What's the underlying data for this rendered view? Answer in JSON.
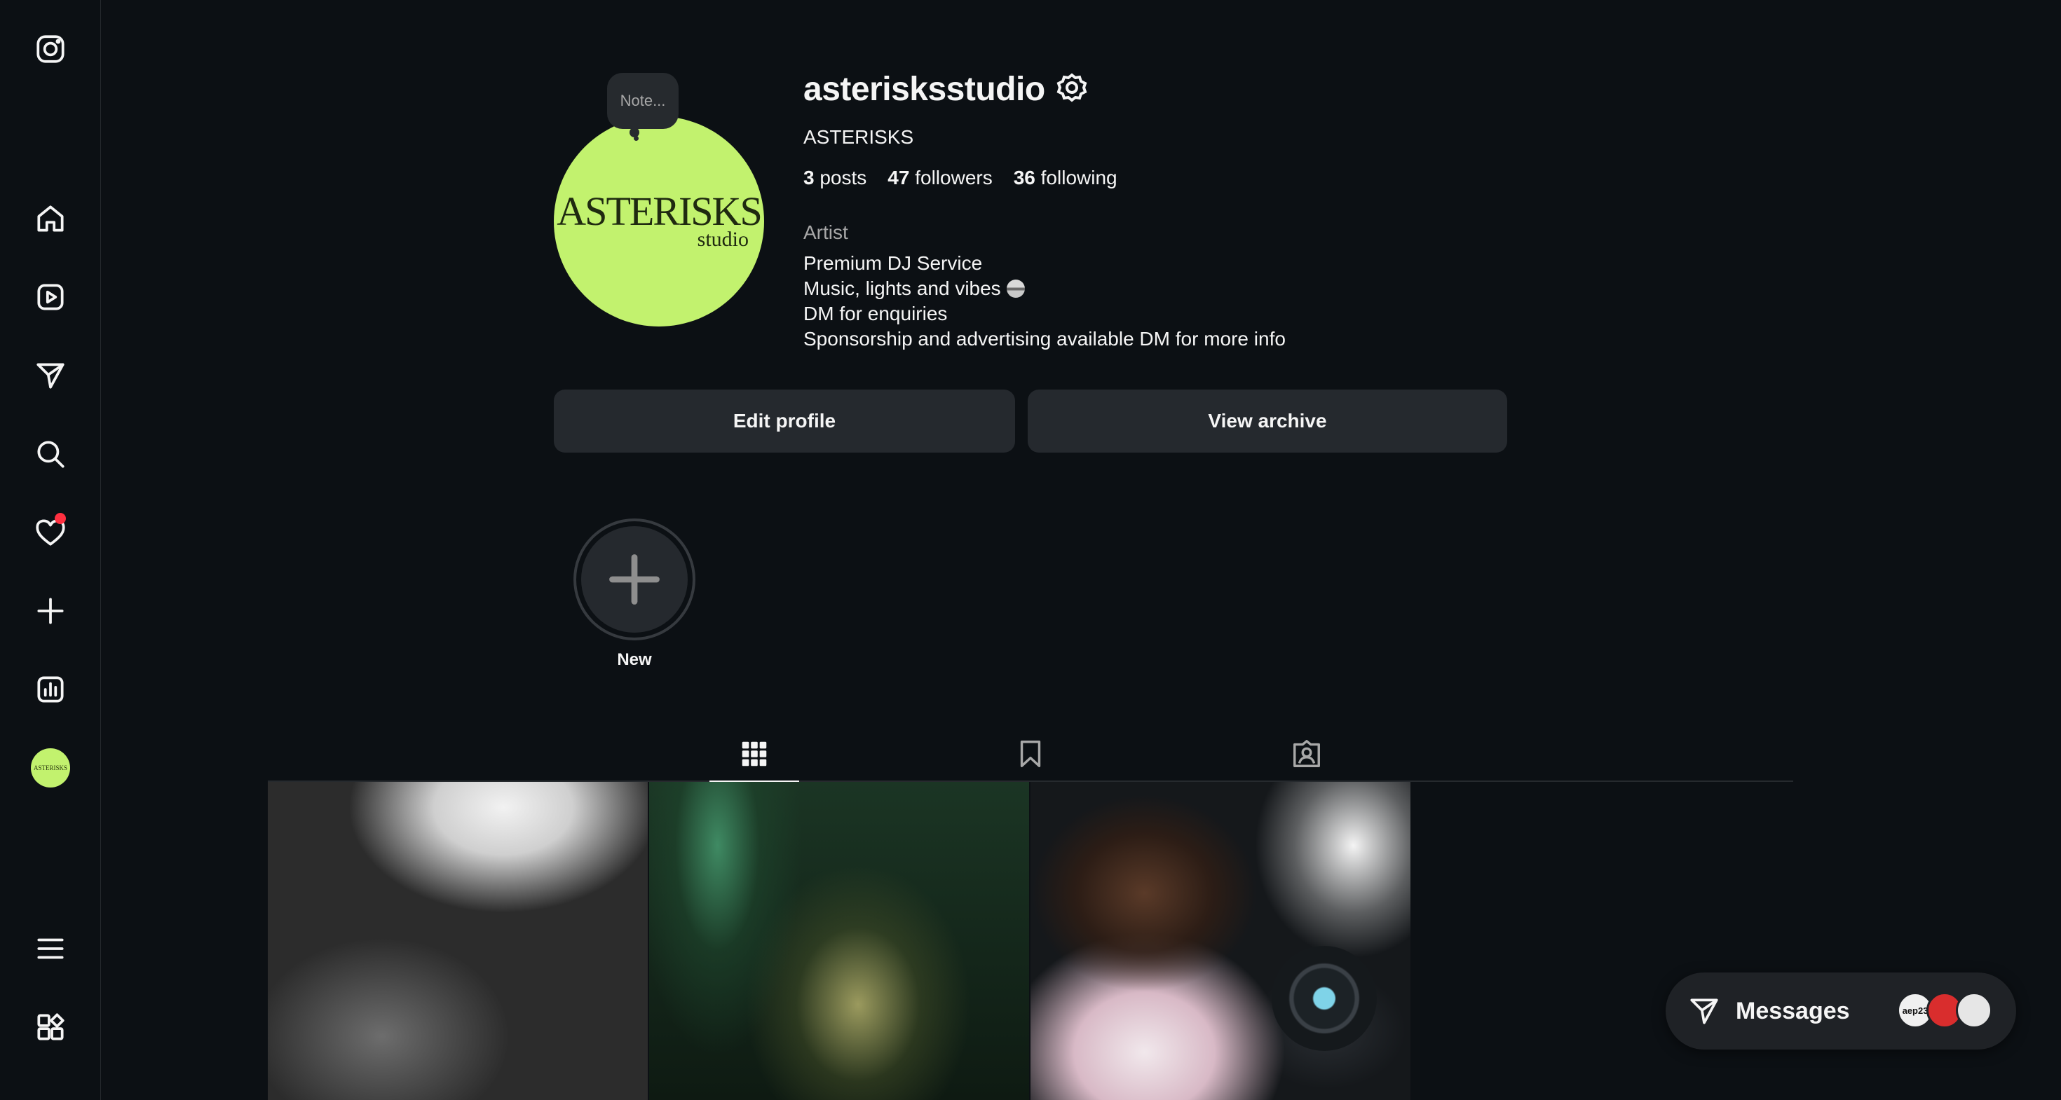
{
  "sidebar": {
    "items": [
      {
        "name": "instagram-logo-icon"
      },
      {
        "name": "home-icon"
      },
      {
        "name": "reels-icon"
      },
      {
        "name": "messages-icon"
      },
      {
        "name": "search-icon"
      },
      {
        "name": "notifications-heart-icon"
      },
      {
        "name": "create-plus-icon"
      },
      {
        "name": "dashboard-chart-icon"
      },
      {
        "name": "profile-avatar"
      },
      {
        "name": "more-menu-icon"
      },
      {
        "name": "apps-grid-icon"
      }
    ],
    "notification_color": "#ff3040"
  },
  "profile": {
    "note_placeholder": "Note...",
    "avatar_text": "ASTERISKS",
    "avatar_subtext": "studio",
    "avatar_color": "#c2f26e",
    "username": "asterisksstudio",
    "full_name": "ASTERISKS",
    "stats": {
      "posts_count": "3",
      "posts_label": "posts",
      "followers_count": "47",
      "followers_label": "followers",
      "following_count": "36",
      "following_label": "following"
    },
    "category": "Artist",
    "bio": [
      "Premium DJ Service",
      "Music, lights and vibes",
      "DM for enquiries",
      "Sponsorship and advertising available DM for more info"
    ],
    "buttons": {
      "edit_profile": "Edit profile",
      "view_archive": "View archive"
    }
  },
  "highlights": {
    "new_label": "New"
  },
  "tabs": [
    {
      "name": "posts-grid",
      "active": true
    },
    {
      "name": "saved",
      "active": false
    },
    {
      "name": "tagged",
      "active": false
    }
  ],
  "posts": [
    {
      "description": "black-and-white crowd photo"
    },
    {
      "description": "green-tinted dancer photo"
    },
    {
      "description": "DJ at decks photo"
    }
  ],
  "messages": {
    "label": "Messages",
    "avatars": [
      "aep23",
      "",
      ""
    ]
  }
}
